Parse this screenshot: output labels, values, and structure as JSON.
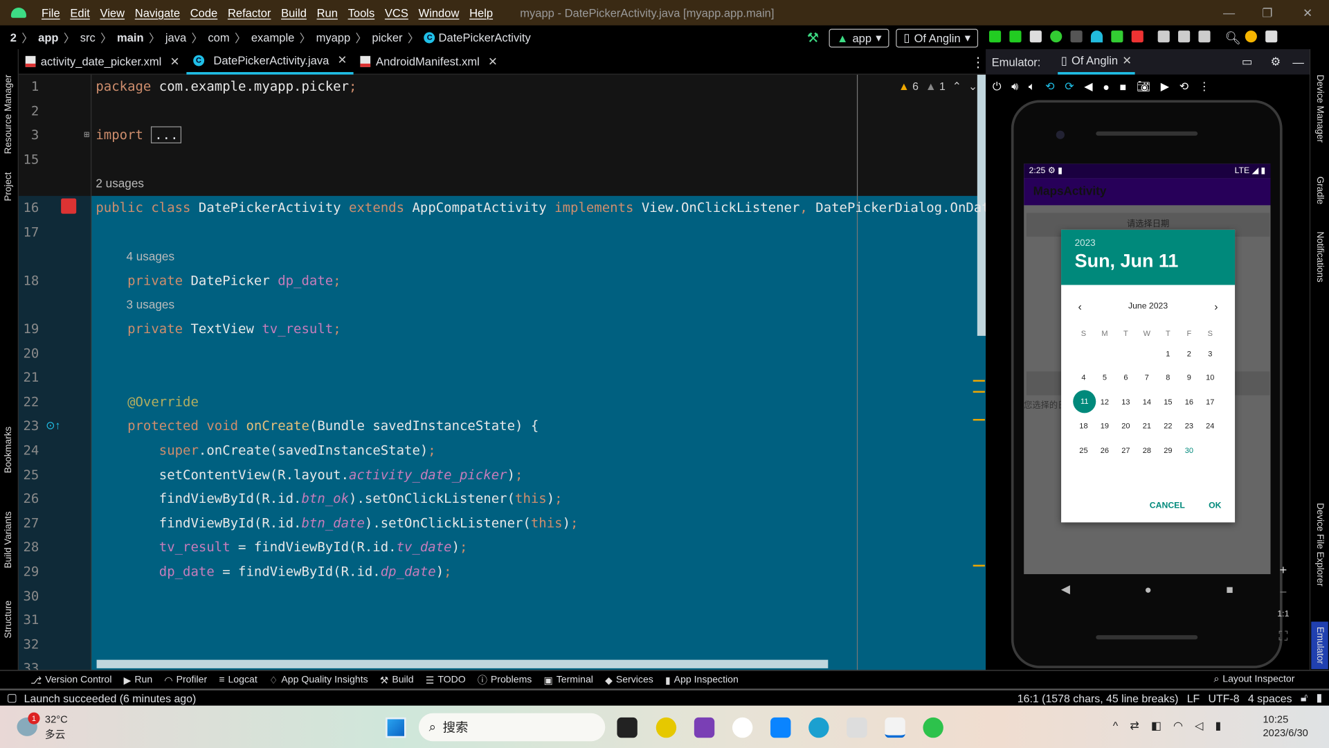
{
  "menu": {
    "items": [
      "File",
      "Edit",
      "View",
      "Navigate",
      "Code",
      "Refactor",
      "Build",
      "Run",
      "Tools",
      "VCS",
      "Window",
      "Help"
    ],
    "title": "myapp - DatePickerActivity.java [myapp.app.main]"
  },
  "breadcrumb": [
    "2",
    "app",
    "src",
    "main",
    "java",
    "com",
    "example",
    "myapp",
    "picker",
    "DatePickerActivity"
  ],
  "toolbar": {
    "run_config": "app",
    "device": "Of Anglin"
  },
  "tabs": [
    {
      "label": "activity_date_picker.xml",
      "icon": "xml-file-icon"
    },
    {
      "label": "DatePickerActivity.java",
      "icon": "class-icon",
      "active": true
    },
    {
      "label": "AndroidManifest.xml",
      "icon": "manifest-icon"
    }
  ],
  "inspections": {
    "warnings": "6",
    "weak_warnings": "1"
  },
  "left_tools": [
    "Resource Manager",
    "Project",
    "Bookmarks",
    "Build Variants",
    "Structure"
  ],
  "right_tools": [
    "Device Manager",
    "Gradle",
    "Notifications",
    "Device File Explorer",
    "Emulator"
  ],
  "code": {
    "lines": [
      {
        "num": "1",
        "segs": [
          [
            "package ",
            "kw"
          ],
          [
            "com.example.myapp.picker",
            "pl"
          ],
          [
            ";",
            "kw"
          ]
        ]
      },
      {
        "num": "2",
        "segs": []
      },
      {
        "num": "3",
        "segs": [
          [
            "import ",
            "kw"
          ],
          [
            "...",
            "box"
          ]
        ]
      },
      {
        "num": "15",
        "segs": []
      },
      {
        "num": "",
        "usage": true,
        "indent": 0,
        "segs": [
          [
            "2 usages",
            "u"
          ]
        ]
      },
      {
        "num": "16",
        "segs": [
          [
            "public class ",
            "kw"
          ],
          [
            "DatePickerActivity ",
            "ty"
          ],
          [
            "extends ",
            "kw"
          ],
          [
            "AppCompatActivity ",
            "ty"
          ],
          [
            "implements ",
            "kw"
          ],
          [
            "View.OnClickListener",
            "ty"
          ],
          [
            ", ",
            "kw"
          ],
          [
            "DatePickerDialog.OnDateSetListener",
            "ty"
          ]
        ]
      },
      {
        "num": "17",
        "segs": []
      },
      {
        "num": "",
        "usage": true,
        "indent": 4,
        "segs": [
          [
            "4 usages",
            "u"
          ]
        ]
      },
      {
        "num": "18",
        "segs": [
          [
            "    private ",
            "kw"
          ],
          [
            "DatePicker ",
            "ty"
          ],
          [
            "dp_date",
            "fd"
          ],
          [
            ";",
            "kw"
          ]
        ]
      },
      {
        "num": "",
        "usage": true,
        "indent": 4,
        "segs": [
          [
            "3 usages",
            "u"
          ]
        ]
      },
      {
        "num": "19",
        "segs": [
          [
            "    private ",
            "kw"
          ],
          [
            "TextView ",
            "ty"
          ],
          [
            "tv_result",
            "fd"
          ],
          [
            ";",
            "kw"
          ]
        ]
      },
      {
        "num": "20",
        "segs": []
      },
      {
        "num": "21",
        "segs": []
      },
      {
        "num": "22",
        "segs": [
          [
            "    @Override",
            "an"
          ]
        ]
      },
      {
        "num": "23",
        "segs": [
          [
            "    protected void ",
            "kw"
          ],
          [
            "onCreate",
            "me"
          ],
          [
            "(Bundle savedInstanceState) {",
            "pl"
          ]
        ]
      },
      {
        "num": "24",
        "segs": [
          [
            "        super",
            "kw"
          ],
          [
            ".onCreate(savedInstanceState)",
            "pl"
          ],
          [
            ";",
            "kw"
          ]
        ]
      },
      {
        "num": "25",
        "segs": [
          [
            "        setContentView(R.layout.",
            "pl"
          ],
          [
            "activity_date_picker",
            "fi"
          ],
          [
            ")",
            "pl"
          ],
          [
            ";",
            "kw"
          ]
        ]
      },
      {
        "num": "26",
        "segs": [
          [
            "        findViewById(R.id.",
            "pl"
          ],
          [
            "btn_ok",
            "fi"
          ],
          [
            ").setOnClickListener(",
            "pl"
          ],
          [
            "this",
            "kw"
          ],
          [
            ")",
            "pl"
          ],
          [
            ";",
            "kw"
          ]
        ]
      },
      {
        "num": "27",
        "segs": [
          [
            "        findViewById(R.id.",
            "pl"
          ],
          [
            "btn_date",
            "fi"
          ],
          [
            ").setOnClickListener(",
            "pl"
          ],
          [
            "this",
            "kw"
          ],
          [
            ")",
            "pl"
          ],
          [
            ";",
            "kw"
          ]
        ]
      },
      {
        "num": "28",
        "segs": [
          [
            "        tv_result",
            "fd"
          ],
          [
            " = findViewById(R.id.",
            "pl"
          ],
          [
            "tv_date",
            "fi"
          ],
          [
            ")",
            "pl"
          ],
          [
            ";",
            "kw"
          ]
        ]
      },
      {
        "num": "29",
        "segs": [
          [
            "        dp_date",
            "fd"
          ],
          [
            " = findViewById(R.id.",
            "pl"
          ],
          [
            "dp_date",
            "fi"
          ],
          [
            ")",
            "pl"
          ],
          [
            ";",
            "kw"
          ]
        ]
      },
      {
        "num": "30",
        "segs": []
      },
      {
        "num": "31",
        "segs": []
      },
      {
        "num": "32",
        "segs": []
      },
      {
        "num": "33",
        "segs": []
      }
    ]
  },
  "emulator": {
    "label": "Emulator:",
    "device": "Of Anglin"
  },
  "phone": {
    "time": "2:25",
    "network": "LTE",
    "app_title": "MapsActivity",
    "button_label": "请选择日期",
    "result_label": "您选择的日",
    "picker": {
      "year": "2023",
      "date": "Sun, Jun 11",
      "month": "June 2023",
      "dow": [
        "S",
        "M",
        "T",
        "W",
        "T",
        "F",
        "S"
      ],
      "weeks": [
        [
          "",
          "",
          "",
          "",
          "1",
          "2",
          "3"
        ],
        [
          "4",
          "5",
          "6",
          "7",
          "8",
          "9",
          "10"
        ],
        [
          "11",
          "12",
          "13",
          "14",
          "15",
          "16",
          "17"
        ],
        [
          "18",
          "19",
          "20",
          "21",
          "22",
          "23",
          "24"
        ],
        [
          "25",
          "26",
          "27",
          "28",
          "29",
          "30",
          ""
        ]
      ],
      "selected": "11",
      "today": "30",
      "cancel": "CANCEL",
      "ok": "OK",
      "accent": "#00897b"
    }
  },
  "bottom_tools": [
    "Version Control",
    "Run",
    "Profiler",
    "Logcat",
    "App Quality Insights",
    "Build",
    "TODO",
    "Problems",
    "Terminal",
    "Services",
    "App Inspection"
  ],
  "layout_inspector": "Layout Inspector",
  "status": {
    "message": "Launch succeeded (6 minutes ago)",
    "position": "16:1 (1578 chars, 45 line breaks)",
    "line_sep": "LF",
    "encoding": "UTF-8",
    "indent": "4 spaces"
  },
  "taskbar": {
    "temp": "32°C",
    "weather": "多云",
    "search": "搜索",
    "time": "10:25",
    "date": "2023/6/30",
    "badge": "1"
  }
}
